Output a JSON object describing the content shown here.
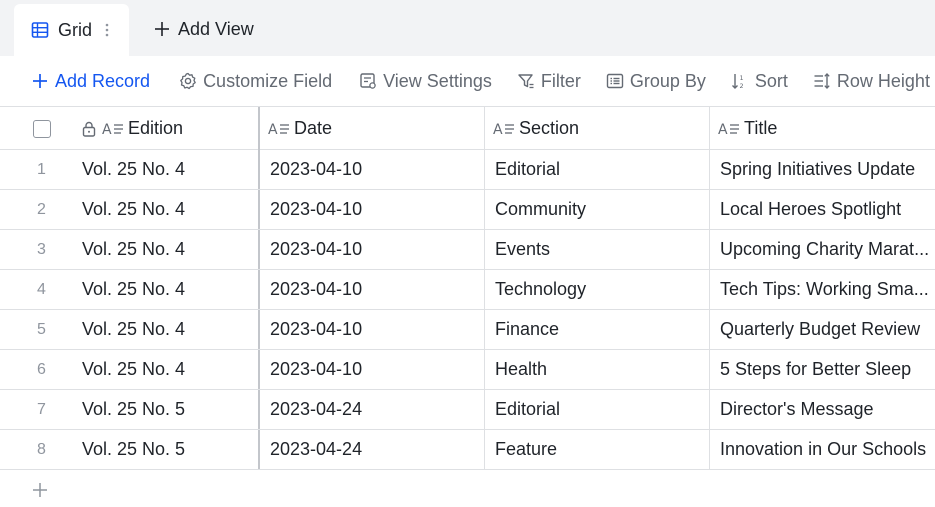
{
  "tabs": {
    "active": {
      "label": "Grid",
      "icon": "grid-view-icon"
    },
    "add_view": {
      "label": "Add View",
      "icon": "plus-icon"
    }
  },
  "toolbar": {
    "add_record": "Add Record",
    "customize_field": "Customize Field",
    "view_settings": "View Settings",
    "filter": "Filter",
    "group_by": "Group By",
    "sort": "Sort",
    "row_height": "Row Height"
  },
  "columns": {
    "edition": "Edition",
    "date": "Date",
    "section": "Section",
    "title": "Title"
  },
  "rows": [
    {
      "num": "1",
      "edition": "Vol. 25 No. 4",
      "date": "2023-04-10",
      "section": "Editorial",
      "title": "Spring Initiatives Update"
    },
    {
      "num": "2",
      "edition": "Vol. 25 No. 4",
      "date": "2023-04-10",
      "section": "Community",
      "title": "Local Heroes Spotlight"
    },
    {
      "num": "3",
      "edition": "Vol. 25 No. 4",
      "date": "2023-04-10",
      "section": "Events",
      "title": "Upcoming Charity Marat..."
    },
    {
      "num": "4",
      "edition": "Vol. 25 No. 4",
      "date": "2023-04-10",
      "section": "Technology",
      "title": "Tech Tips: Working Sma..."
    },
    {
      "num": "5",
      "edition": "Vol. 25 No. 4",
      "date": "2023-04-10",
      "section": "Finance",
      "title": "Quarterly Budget Review"
    },
    {
      "num": "6",
      "edition": "Vol. 25 No. 4",
      "date": "2023-04-10",
      "section": "Health",
      "title": "5 Steps for Better Sleep"
    },
    {
      "num": "7",
      "edition": "Vol. 25 No. 5",
      "date": "2023-04-24",
      "section": "Editorial",
      "title": "Director's Message"
    },
    {
      "num": "8",
      "edition": "Vol. 25 No. 5",
      "date": "2023-04-24",
      "section": "Feature",
      "title": "Innovation in Our Schools"
    }
  ],
  "colors": {
    "accent": "#1456f0",
    "toolbar_text": "#646a73",
    "border": "#dee0e3",
    "tab_bar_bg": "#f2f3f5"
  }
}
